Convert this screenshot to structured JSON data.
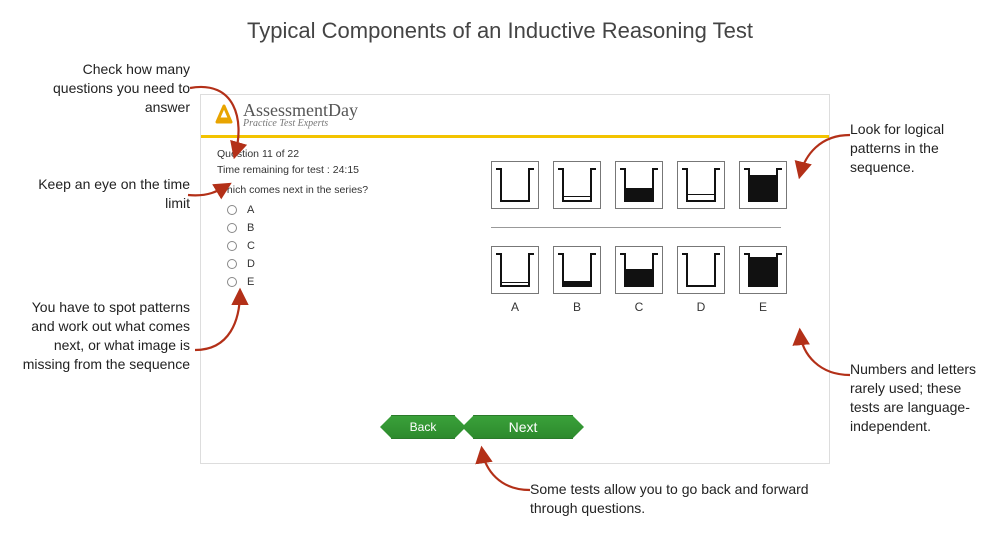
{
  "page_title": "Typical Components of an Inductive Reasoning Test",
  "annotations": {
    "questions_count": "Check how many questions you need to answer",
    "time_limit": "Keep an eye on the time limit",
    "pattern_spot": "You have to spot patterns and work out what comes next, or what image is missing from the sequence",
    "look_logical": "Look for logical patterns in the sequence.",
    "language_independent": "Numbers and letters rarely used; these tests are language-independent.",
    "nav_note": "Some tests allow you to go back and forward through questions."
  },
  "app": {
    "brand_main": "AssessmentDay",
    "brand_sub": "Practice Test Experts",
    "question_counter": "Question 11 of 22",
    "time_remaining": "Time remaining for test : 24:15",
    "prompt": "Which comes next in the series?",
    "options": [
      "A",
      "B",
      "C",
      "D",
      "E"
    ],
    "answer_labels": [
      "A",
      "B",
      "C",
      "D",
      "E"
    ],
    "nav": {
      "back": "Back",
      "next": "Next"
    }
  },
  "sequence": {
    "top_row_fill_pct": [
      0,
      10,
      40,
      18,
      85
    ],
    "top_row_style": [
      "empty",
      "line",
      "fill",
      "line",
      "fill"
    ],
    "answer_row_fill_pct": [
      8,
      12,
      55,
      0,
      95
    ],
    "answer_row_style": [
      "line",
      "fill",
      "fill",
      "empty",
      "fill"
    ]
  },
  "colors": {
    "accent_gold": "#f3c300",
    "button_green": "#2d8a2d",
    "arrow_red": "#b33018"
  }
}
